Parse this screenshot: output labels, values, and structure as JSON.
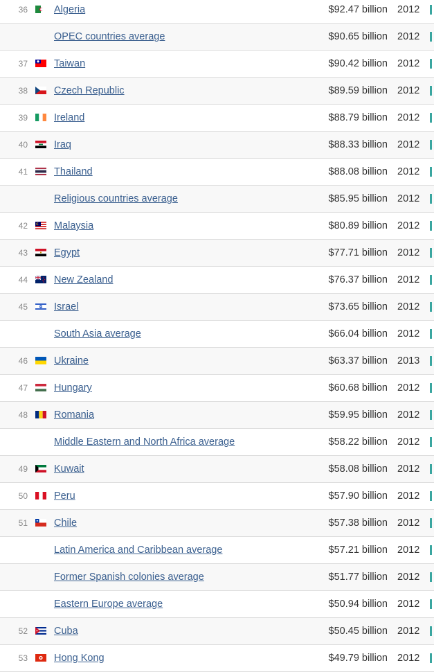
{
  "rows": [
    {
      "rank": "36",
      "flag": "algeria",
      "name": "Algeria",
      "value": "$92.47 billion",
      "year": "2012",
      "bar_color": "#3aa6a0"
    },
    {
      "rank": "",
      "flag": "",
      "name": "OPEC countries average",
      "value": "$90.65 billion",
      "year": "2012",
      "bar_color": "#3aa6a0"
    },
    {
      "rank": "37",
      "flag": "taiwan",
      "name": "Taiwan",
      "value": "$90.42 billion",
      "year": "2012",
      "bar_color": "#3aa6a0"
    },
    {
      "rank": "38",
      "flag": "czech",
      "name": "Czech Republic",
      "value": "$89.59 billion",
      "year": "2012",
      "bar_color": "#3aa6a0"
    },
    {
      "rank": "39",
      "flag": "ireland",
      "name": "Ireland",
      "value": "$88.79 billion",
      "year": "2012",
      "bar_color": "#3aa6a0"
    },
    {
      "rank": "40",
      "flag": "iraq",
      "name": "Iraq",
      "value": "$88.33 billion",
      "year": "2012",
      "bar_color": "#3aa6a0"
    },
    {
      "rank": "41",
      "flag": "thailand",
      "name": "Thailand",
      "value": "$88.08 billion",
      "year": "2012",
      "bar_color": "#3aa6a0"
    },
    {
      "rank": "",
      "flag": "",
      "name": "Religious countries average",
      "value": "$85.95 billion",
      "year": "2012",
      "bar_color": "#3aa6a0"
    },
    {
      "rank": "42",
      "flag": "malaysia",
      "name": "Malaysia",
      "value": "$80.89 billion",
      "year": "2012",
      "bar_color": "#3aa6a0"
    },
    {
      "rank": "43",
      "flag": "egypt",
      "name": "Egypt",
      "value": "$77.71 billion",
      "year": "2012",
      "bar_color": "#3aa6a0"
    },
    {
      "rank": "44",
      "flag": "newzealand",
      "name": "New Zealand",
      "value": "$76.37 billion",
      "year": "2012",
      "bar_color": "#3aa6a0"
    },
    {
      "rank": "45",
      "flag": "israel",
      "name": "Israel",
      "value": "$73.65 billion",
      "year": "2012",
      "bar_color": "#3aa6a0"
    },
    {
      "rank": "",
      "flag": "",
      "name": "South Asia average",
      "value": "$66.04 billion",
      "year": "2012",
      "bar_color": "#3aa6a0"
    },
    {
      "rank": "46",
      "flag": "ukraine",
      "name": "Ukraine",
      "value": "$63.37 billion",
      "year": "2013",
      "bar_color": "#3aa6a0"
    },
    {
      "rank": "47",
      "flag": "hungary",
      "name": "Hungary",
      "value": "$60.68 billion",
      "year": "2012",
      "bar_color": "#3aa6a0"
    },
    {
      "rank": "48",
      "flag": "romania",
      "name": "Romania",
      "value": "$59.95 billion",
      "year": "2012",
      "bar_color": "#3aa6a0"
    },
    {
      "rank": "",
      "flag": "",
      "name": "Middle Eastern and North Africa average",
      "value": "$58.22 billion",
      "year": "2012",
      "bar_color": "#3aa6a0"
    },
    {
      "rank": "49",
      "flag": "kuwait",
      "name": "Kuwait",
      "value": "$58.08 billion",
      "year": "2012",
      "bar_color": "#3aa6a0"
    },
    {
      "rank": "50",
      "flag": "peru",
      "name": "Peru",
      "value": "$57.90 billion",
      "year": "2012",
      "bar_color": "#3aa6a0"
    },
    {
      "rank": "51",
      "flag": "chile",
      "name": "Chile",
      "value": "$57.38 billion",
      "year": "2012",
      "bar_color": "#3aa6a0"
    },
    {
      "rank": "",
      "flag": "",
      "name": "Latin America and Caribbean average",
      "value": "$57.21 billion",
      "year": "2012",
      "bar_color": "#3aa6a0"
    },
    {
      "rank": "",
      "flag": "",
      "name": "Former Spanish colonies average",
      "value": "$51.77 billion",
      "year": "2012",
      "bar_color": "#3aa6a0"
    },
    {
      "rank": "",
      "flag": "",
      "name": "Eastern Europe average",
      "value": "$50.94 billion",
      "year": "2012",
      "bar_color": "#3aa6a0"
    },
    {
      "rank": "52",
      "flag": "cuba",
      "name": "Cuba",
      "value": "$50.45 billion",
      "year": "2012",
      "bar_color": "#3aa6a0"
    },
    {
      "rank": "53",
      "flag": "hongkong",
      "name": "Hong Kong",
      "value": "$49.79 billion",
      "year": "2012",
      "bar_color": "#3aa6a0"
    }
  ]
}
